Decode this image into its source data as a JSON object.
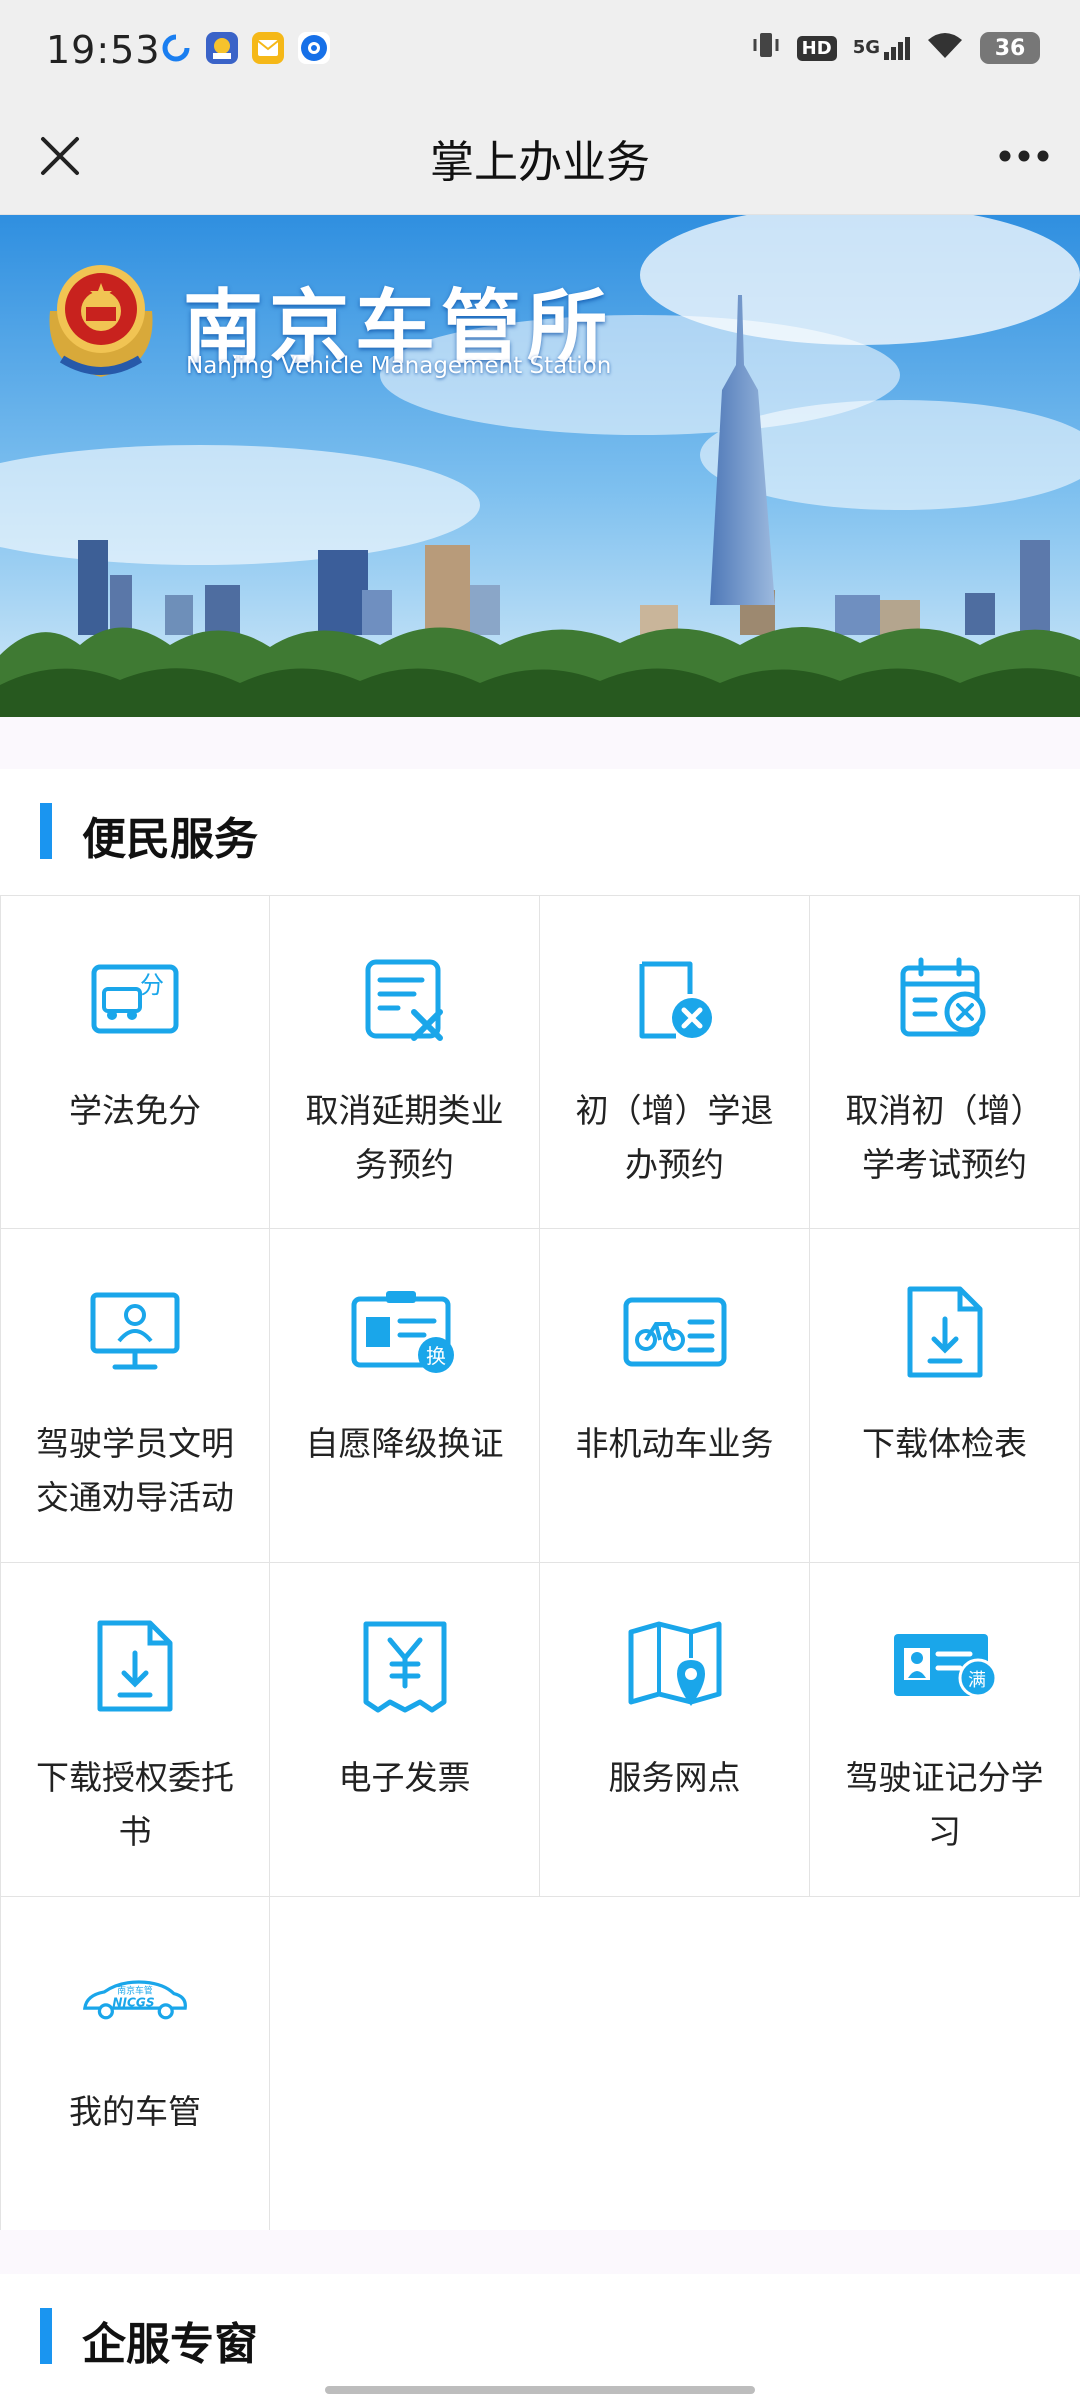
{
  "status_bar": {
    "time": "19:53",
    "network": "5G",
    "hd_badge": "HD",
    "battery": "36"
  },
  "header": {
    "title": "掌上办业务",
    "close_icon": "close-icon",
    "more_icon": "more-icon"
  },
  "banner": {
    "title": "南京车管所",
    "subtitle": "Nanjing Vehicle Management Station"
  },
  "sections": [
    {
      "title": "便民服务",
      "items": [
        {
          "label": "学法免分",
          "icon": "study-deduction-icon"
        },
        {
          "label": "取消延期类业务预约",
          "icon": "cancel-document-icon"
        },
        {
          "label": "初（增）学退办预约",
          "icon": "cancel-booking-icon"
        },
        {
          "label": "取消初（增）学考试预约",
          "icon": "cancel-calendar-icon"
        },
        {
          "label": "驾驶学员文明交通劝导活动",
          "icon": "monitor-person-icon"
        },
        {
          "label": "自愿降级换证",
          "icon": "id-card-swap-icon"
        },
        {
          "label": "非机动车业务",
          "icon": "bicycle-card-icon"
        },
        {
          "label": "下载体检表",
          "icon": "download-document-icon"
        },
        {
          "label": "下载授权委托书",
          "icon": "download-document-icon"
        },
        {
          "label": "电子发票",
          "icon": "invoice-icon"
        },
        {
          "label": "服务网点",
          "icon": "map-pin-icon"
        },
        {
          "label": "驾驶证记分学习",
          "icon": "id-card-full-icon"
        },
        {
          "label": "我的车管",
          "icon": "njcgs-car-icon"
        }
      ]
    },
    {
      "title": "企服专窗"
    }
  ],
  "colors": {
    "accent": "#1a95f0",
    "icon_blue": "#1aa6ea",
    "background": "#ffffff",
    "header_bg": "#efefef"
  }
}
